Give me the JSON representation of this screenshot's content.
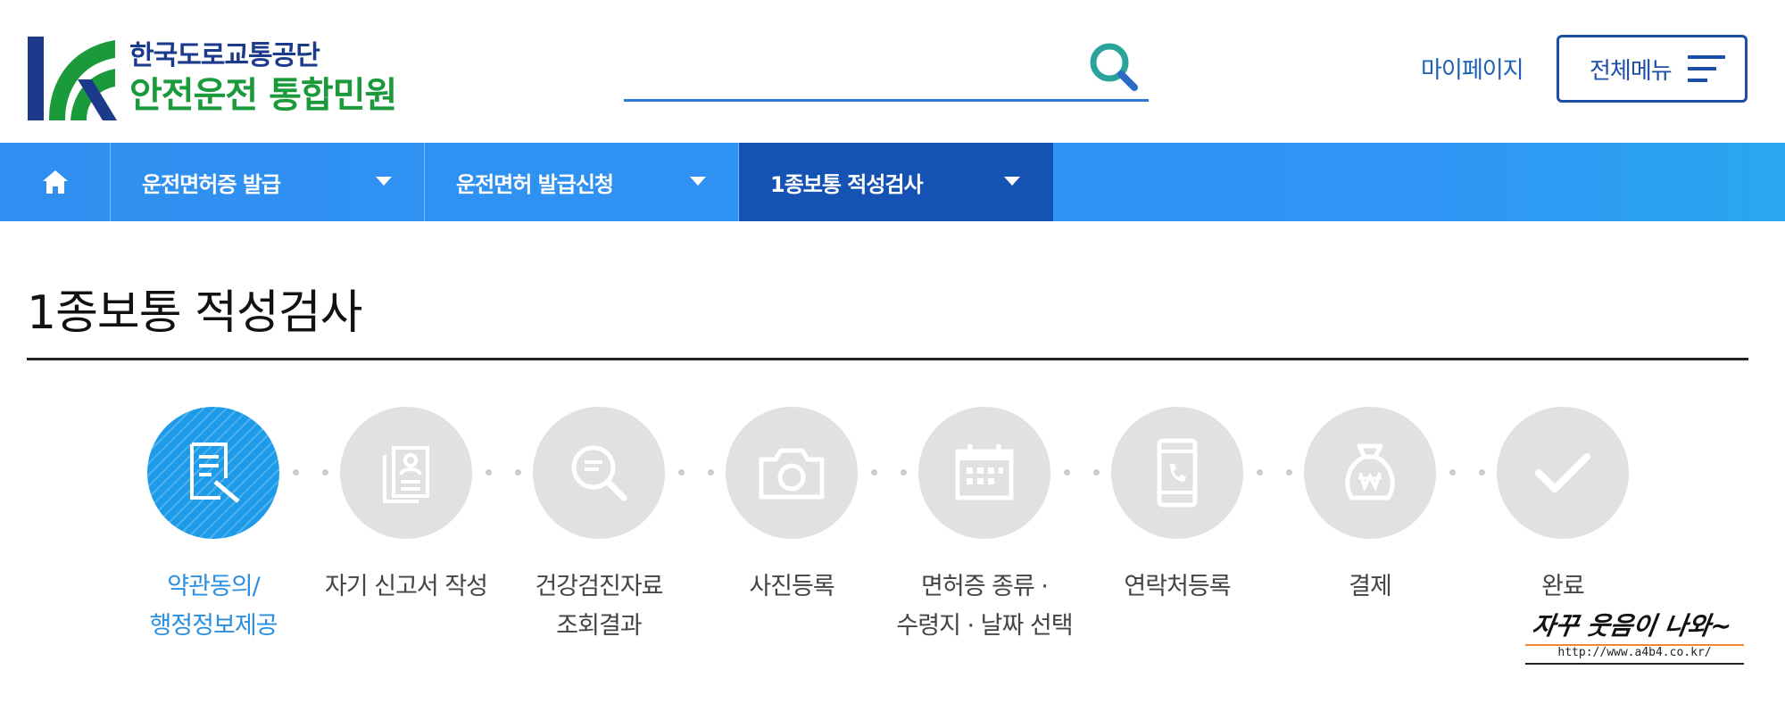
{
  "header": {
    "org_name": "한국도로교통공단",
    "service_title": "안전운전 통합민원",
    "search_placeholder": "",
    "mypage_label": "마이페이지",
    "allmenu_label": "전체메뉴"
  },
  "nav": {
    "home_icon": "home-icon",
    "items": [
      {
        "label": "운전면허증 발급",
        "active": false
      },
      {
        "label": "운전면허 발급신청",
        "active": false
      },
      {
        "label": "1종보통 적성검사",
        "active": true
      }
    ]
  },
  "page": {
    "title": "1종보통 적성검사"
  },
  "steps": [
    {
      "label": "약관동의/\n행정정보제공",
      "icon": "document-edit-icon",
      "active": true
    },
    {
      "label": "자기 신고서 작성",
      "icon": "profile-document-icon",
      "active": false
    },
    {
      "label": "건강검진자료\n조회결과",
      "icon": "search-document-icon",
      "active": false
    },
    {
      "label": "사진등록",
      "icon": "camera-icon",
      "active": false
    },
    {
      "label": "면허증 종류 ·\n수령지 · 날짜 선택",
      "icon": "calendar-icon",
      "active": false
    },
    {
      "label": "연락처등록",
      "icon": "mobile-phone-icon",
      "active": false
    },
    {
      "label": "결제",
      "icon": "money-bag-icon",
      "active": false
    },
    {
      "label": "완료",
      "icon": "check-icon",
      "active": false
    }
  ],
  "watermark": {
    "text": "자꾸 웃음이 나와~",
    "url": "http://www.a4b4.co.kr/"
  },
  "colors": {
    "nav_bg": "#2f8ff0",
    "nav_active": "#1452b4",
    "step_active": "#1e9be8",
    "step_inactive": "#e1e1e1",
    "brand_blue": "#1b3a8c",
    "brand_green": "#1b9a3c"
  }
}
